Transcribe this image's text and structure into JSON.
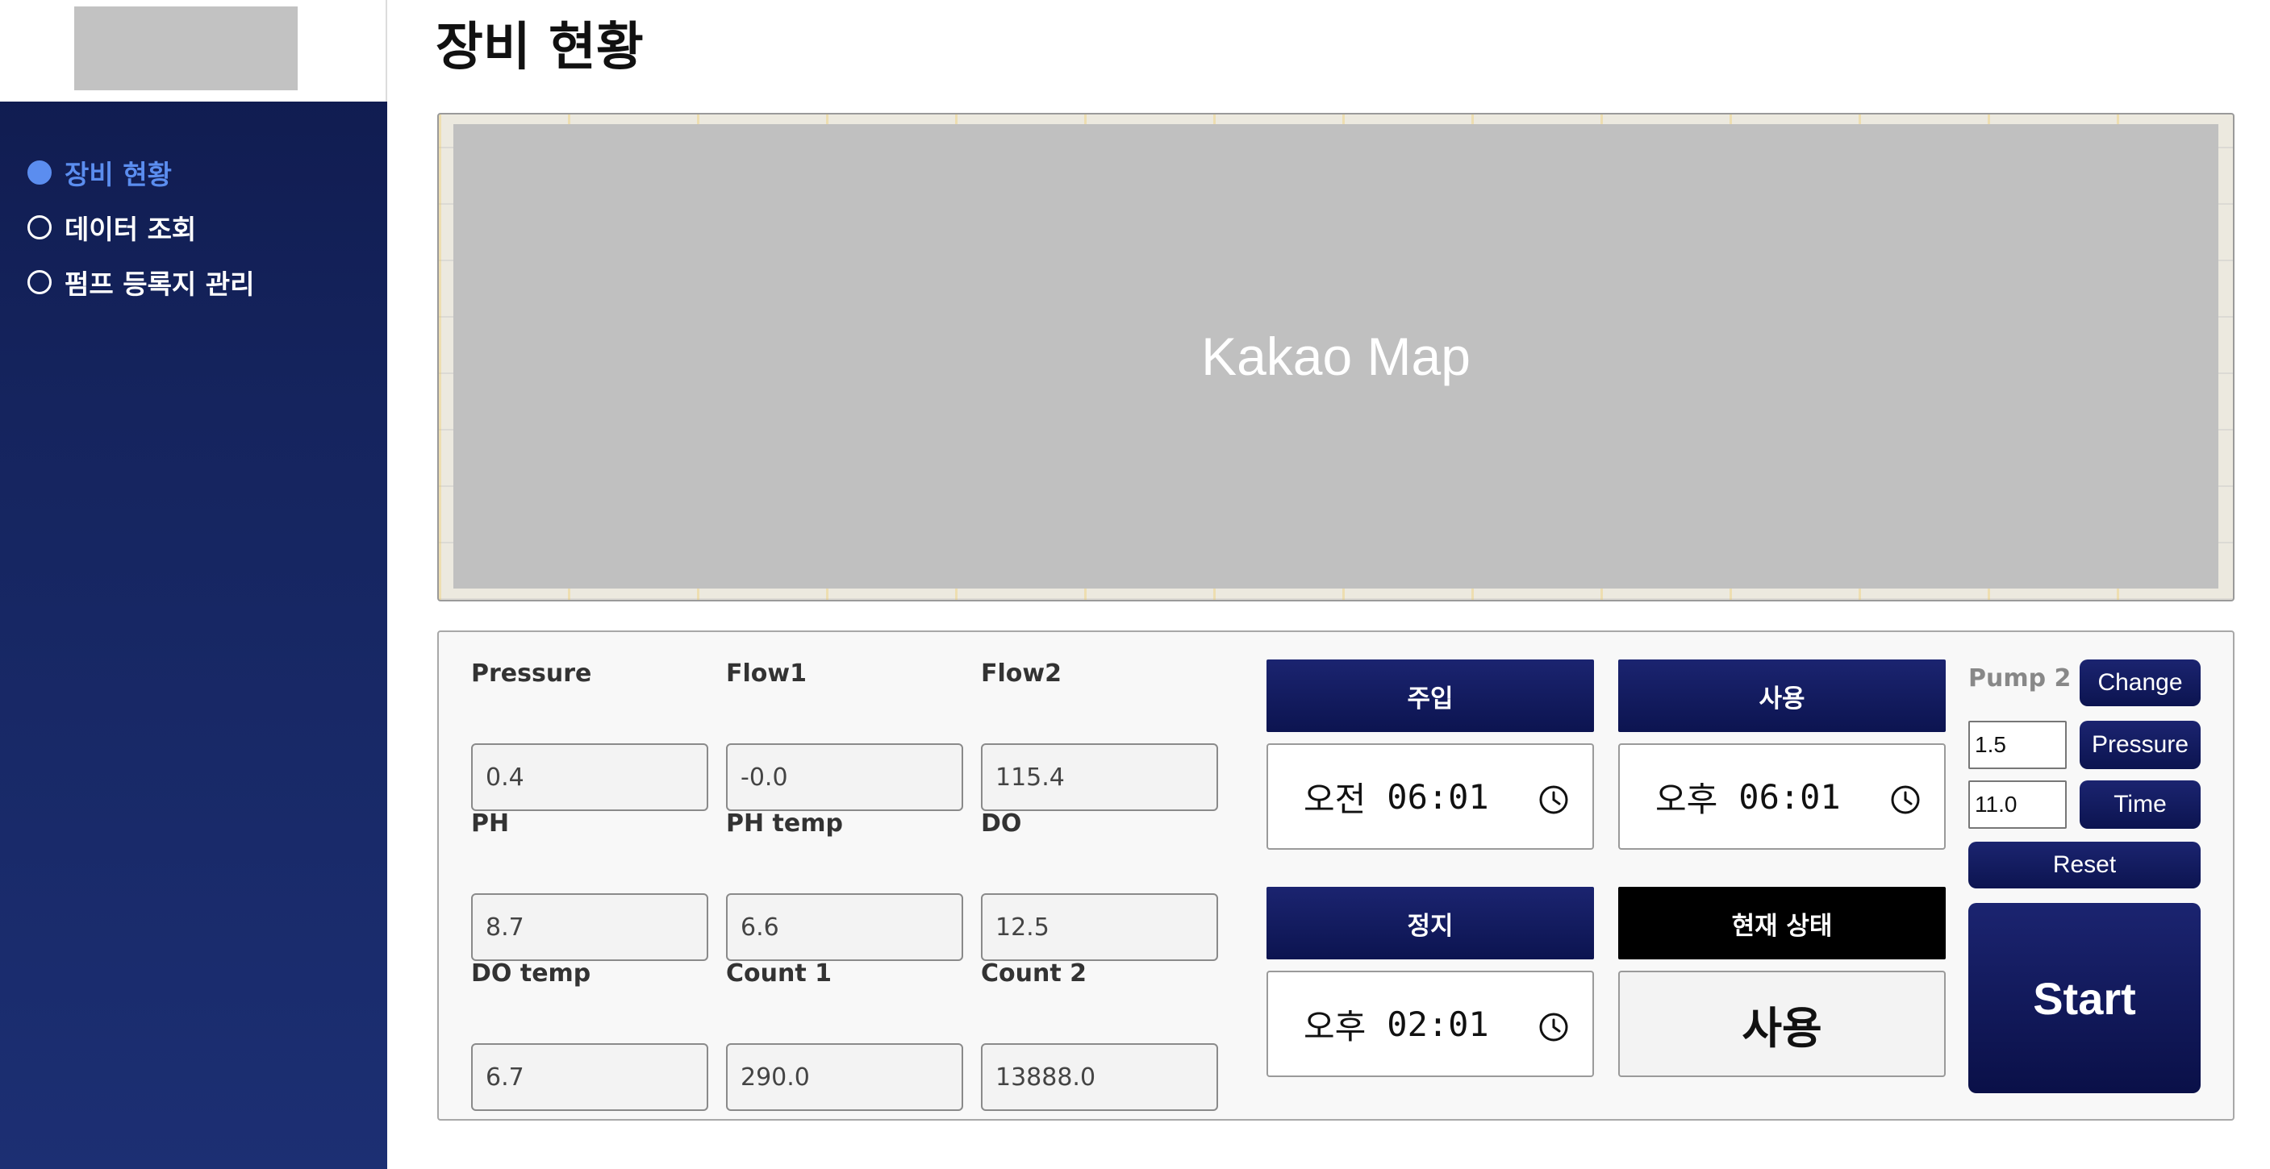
{
  "sidebar": {
    "items": [
      {
        "label": "장비 현황",
        "active": true
      },
      {
        "label": "데이터 조회",
        "active": false
      },
      {
        "label": "펌프 등록지 관리",
        "active": false
      }
    ]
  },
  "page": {
    "title": "장비 현황"
  },
  "map": {
    "label": "Kakao Map"
  },
  "sensors": {
    "pressure": {
      "label": "Pressure",
      "value": "0.4"
    },
    "flow1": {
      "label": "Flow1",
      "value": "-0.0"
    },
    "flow2": {
      "label": "Flow2",
      "value": "115.4"
    },
    "ph": {
      "label": "PH",
      "value": "8.7"
    },
    "ph_temp": {
      "label": "PH temp",
      "value": "6.6"
    },
    "do": {
      "label": "DO",
      "value": "12.5"
    },
    "do_temp": {
      "label": "DO temp",
      "value": "6.7"
    },
    "count1": {
      "label": "Count 1",
      "value": "290.0"
    },
    "count2": {
      "label": "Count 2",
      "value": "13888.0"
    }
  },
  "schedule": {
    "inject": {
      "label": "주입",
      "ampm": "오전",
      "time": "06:01"
    },
    "use": {
      "label": "사용",
      "ampm": "오후",
      "time": "06:01"
    },
    "stop": {
      "label": "정지",
      "ampm": "오후",
      "time": "02:01"
    },
    "current": {
      "label": "현재 상태",
      "value": "사용"
    }
  },
  "pump": {
    "label": "Pump 2",
    "change_label": "Change",
    "pressure_value": "1.5",
    "pressure_label": "Pressure",
    "time_value": "11.0",
    "time_label": "Time",
    "reset_label": "Reset",
    "start_label": "Start"
  },
  "colors": {
    "sidebar_top": "#0f1a4d",
    "sidebar_bottom": "#1c2f73",
    "active_nav": "#5b8def",
    "button_navy": "#0c1450",
    "status_black": "#000000"
  }
}
